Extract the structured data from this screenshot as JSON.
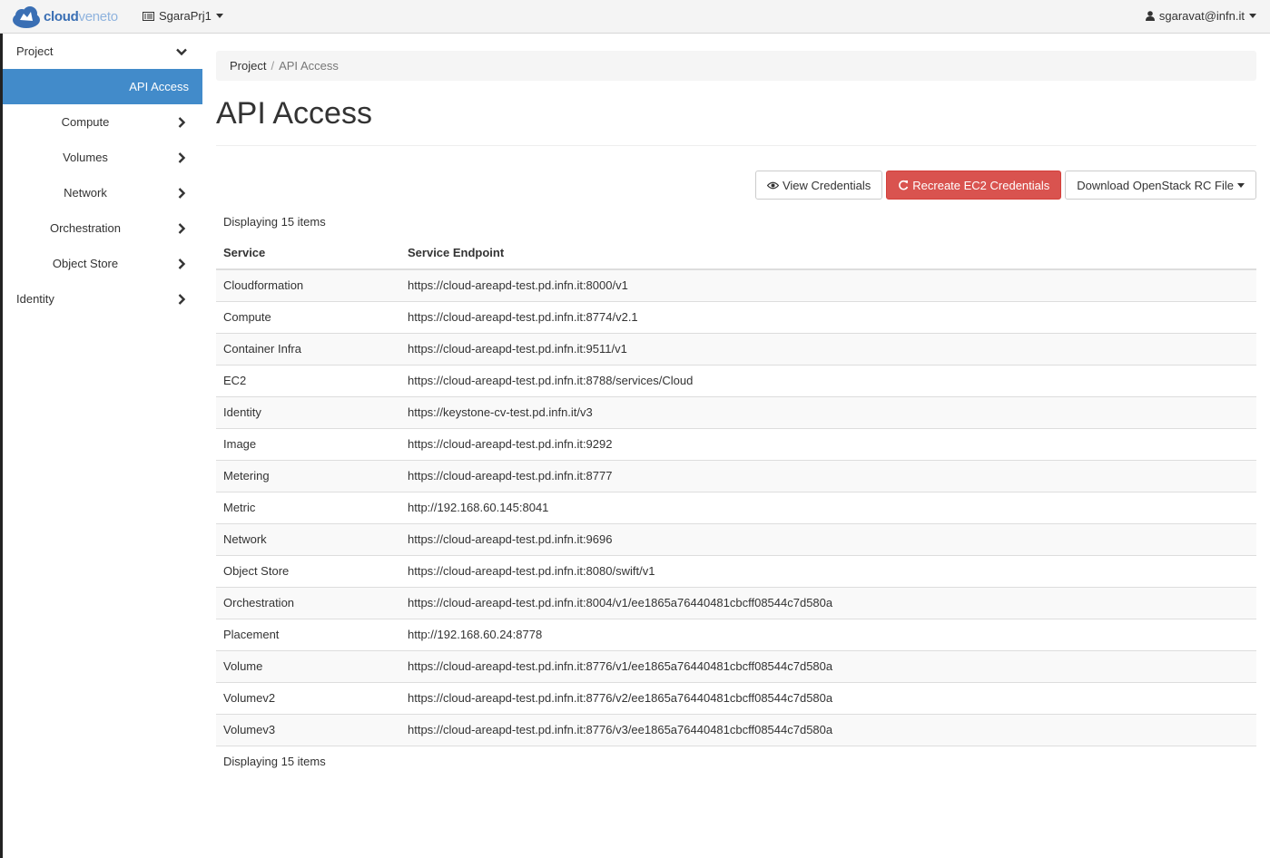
{
  "brand": {
    "part1": "cloud",
    "part2": "veneto"
  },
  "navbar": {
    "project": "SgaraPrj1",
    "user": "sgaravat@infn.it"
  },
  "sidebar": {
    "project": "Project",
    "api_access": "API Access",
    "items": [
      "Compute",
      "Volumes",
      "Network",
      "Orchestration",
      "Object Store"
    ],
    "identity": "Identity"
  },
  "breadcrumb": {
    "root": "Project",
    "sep": "/",
    "current": "API Access"
  },
  "page_title": "API Access",
  "buttons": {
    "view": "View Credentials",
    "recreate": "Recreate EC2 Credentials",
    "download": "Download OpenStack RC File"
  },
  "table": {
    "count_label": "Displaying 15 items",
    "headers": [
      "Service",
      "Service Endpoint"
    ],
    "rows": [
      [
        "Cloudformation",
        "https://cloud-areapd-test.pd.infn.it:8000/v1"
      ],
      [
        "Compute",
        "https://cloud-areapd-test.pd.infn.it:8774/v2.1"
      ],
      [
        "Container Infra",
        "https://cloud-areapd-test.pd.infn.it:9511/v1"
      ],
      [
        "EC2",
        "https://cloud-areapd-test.pd.infn.it:8788/services/Cloud"
      ],
      [
        "Identity",
        "https://keystone-cv-test.pd.infn.it/v3"
      ],
      [
        "Image",
        "https://cloud-areapd-test.pd.infn.it:9292"
      ],
      [
        "Metering",
        "https://cloud-areapd-test.pd.infn.it:8777"
      ],
      [
        "Metric",
        "http://192.168.60.145:8041"
      ],
      [
        "Network",
        "https://cloud-areapd-test.pd.infn.it:9696"
      ],
      [
        "Object Store",
        "https://cloud-areapd-test.pd.infn.it:8080/swift/v1"
      ],
      [
        "Orchestration",
        "https://cloud-areapd-test.pd.infn.it:8004/v1/ee1865a76440481cbcff08544c7d580a"
      ],
      [
        "Placement",
        "http://192.168.60.24:8778"
      ],
      [
        "Volume",
        "https://cloud-areapd-test.pd.infn.it:8776/v1/ee1865a76440481cbcff08544c7d580a"
      ],
      [
        "Volumev2",
        "https://cloud-areapd-test.pd.infn.it:8776/v2/ee1865a76440481cbcff08544c7d580a"
      ],
      [
        "Volumev3",
        "https://cloud-areapd-test.pd.infn.it:8776/v3/ee1865a76440481cbcff08544c7d580a"
      ]
    ]
  },
  "colors": {
    "active": "#428bca",
    "danger": "#d9534f",
    "brand": "#3a6fb4"
  }
}
